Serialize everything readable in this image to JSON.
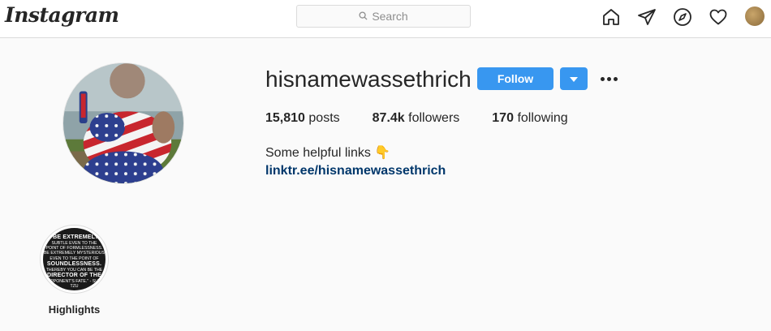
{
  "nav": {
    "logo": "Instagram",
    "search_placeholder": "Search",
    "icons": [
      "home-icon",
      "direct-icon",
      "explore-icon",
      "activity-icon",
      "profile-avatar"
    ]
  },
  "profile": {
    "username": "hisnamewassethrich",
    "follow_label": "Follow",
    "stats": {
      "posts_count": "15,810",
      "posts_label": "posts",
      "followers_count": "87.4k",
      "followers_label": "followers",
      "following_count": "170",
      "following_label": "following"
    },
    "bio": "Some helpful links 👇",
    "link": "linktr.ee/hisnamewassethrich"
  },
  "highlights": [
    {
      "label": "Highlights",
      "cover_text": [
        "\"BE EXTREMELY",
        "SUBTLE EVEN TO THE",
        "POINT OF FORMLESSNESS.",
        "BE EXTREMELY MYSTERIOUS",
        "EVEN TO THE POINT OF",
        "SOUNDLESSNESS.",
        "THEREBY YOU CAN BE THE",
        "DIRECTOR OF THE",
        "OPPONENT'S FATE.\" - SUN TZU"
      ]
    }
  ],
  "colors": {
    "accent": "#3897f0",
    "link": "#00376b",
    "background": "#fafafa",
    "border": "#dbdbdb"
  }
}
